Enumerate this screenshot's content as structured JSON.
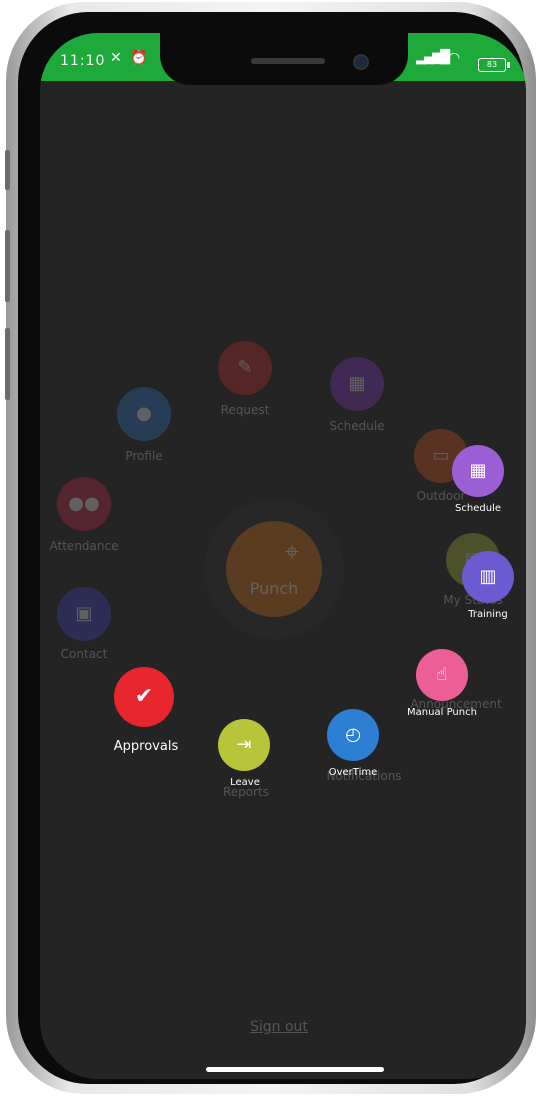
{
  "status": {
    "time": "11:10",
    "battery": "83"
  },
  "center": {
    "label": "Punch"
  },
  "back_menu": {
    "request": "Request",
    "schedule": "Schedule",
    "profile": "Profile",
    "outdoor": "Outdoor",
    "attendance": "Attendance",
    "my_status": "My Status",
    "contact": "Contact",
    "announcement": "Announcement",
    "notifications": "Notifications",
    "reports": "Reports"
  },
  "front_menu": {
    "schedule": "Schedule",
    "training": "Training",
    "manual_punch": "Manual Punch",
    "approvals": "Approvals",
    "leave": "Leave",
    "overtime": "OverTime"
  },
  "footer": {
    "sign_out": "Sign out"
  },
  "colors": {
    "status_bar": "#1eaa3a",
    "screen_bg": "#242424",
    "punch": "#e67a1a",
    "approvals": "#e8262e",
    "leave": "#b8c43a",
    "overtime": "#2d7fd4",
    "manual_punch": "#ec5f96",
    "training": "#6c5bd0",
    "schedule": "#9a5fd4"
  }
}
